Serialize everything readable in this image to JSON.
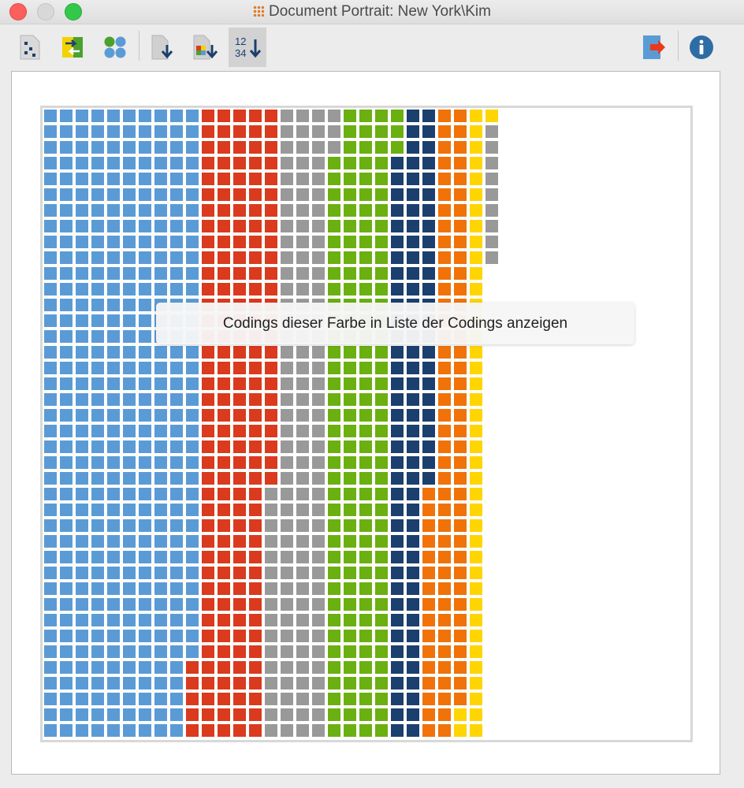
{
  "window": {
    "title": "Document Portrait: New York\\Kim"
  },
  "toolbar": {
    "buttons": [
      {
        "name": "grid-view-icon"
      },
      {
        "name": "swap-icon"
      },
      {
        "name": "circles-icon"
      },
      {
        "name": "sort-down-icon"
      },
      {
        "name": "sort-color-icon"
      },
      {
        "name": "sort-numeric-icon",
        "label": "12\n34",
        "active": true
      },
      {
        "name": "export-icon"
      },
      {
        "name": "info-icon",
        "label": "i"
      }
    ]
  },
  "tooltip": {
    "text": "Codings dieser Farbe in Liste der Codings anzeigen"
  },
  "portrait": {
    "rows": 40,
    "colors": {
      "blue": "#5b9bd5",
      "red": "#da3a1e",
      "gray": "#999999",
      "green": "#6ab010",
      "navy": "#1b3f6e",
      "orange": "#f07209",
      "yellow": "#fed500"
    },
    "sequence": [
      {
        "color": "blue",
        "count": 395
      },
      {
        "color": "red",
        "count": 189
      },
      {
        "color": "gray",
        "count": 139
      },
      {
        "color": "green",
        "count": 160
      },
      {
        "color": "navy",
        "count": 101
      },
      {
        "color": "orange",
        "count": 94
      },
      {
        "color": "yellow",
        "count": 43
      },
      {
        "color": "gray",
        "count": 9
      }
    ]
  }
}
